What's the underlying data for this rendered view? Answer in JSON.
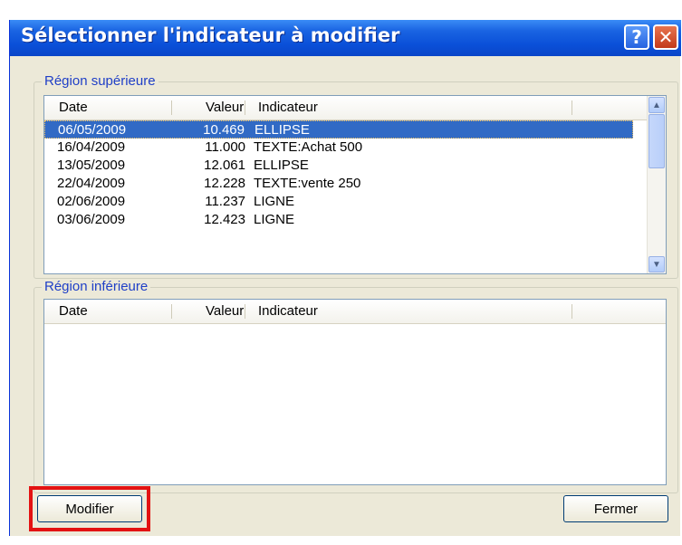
{
  "window": {
    "title": "Sélectionner l'indicateur à modifier",
    "help_label": "?",
    "close_label": "✕"
  },
  "upper_group": {
    "label": "Région supérieure",
    "columns": [
      "Date",
      "Valeur",
      "Indicateur"
    ],
    "rows": [
      {
        "date": "06/05/2009",
        "value": "10.469",
        "indicator": "ELLIPSE",
        "selected": true
      },
      {
        "date": "16/04/2009",
        "value": "11.000",
        "indicator": "TEXTE:Achat 500",
        "selected": false
      },
      {
        "date": "13/05/2009",
        "value": "12.061",
        "indicator": "ELLIPSE",
        "selected": false
      },
      {
        "date": "22/04/2009",
        "value": "12.228",
        "indicator": "TEXTE:vente 250",
        "selected": false
      },
      {
        "date": "02/06/2009",
        "value": "11.237",
        "indicator": "LIGNE",
        "selected": false
      },
      {
        "date": "03/06/2009",
        "value": "12.423",
        "indicator": "LIGNE",
        "selected": false
      }
    ],
    "scroll_up_icon": "chevron-up-icon",
    "scroll_down_icon": "chevron-down-icon"
  },
  "lower_group": {
    "label": "Région inférieure",
    "columns": [
      "Date",
      "Valeur",
      "Indicateur"
    ],
    "rows": []
  },
  "buttons": {
    "modify": "Modifier",
    "close": "Fermer"
  },
  "colors": {
    "title_bar": "#0a4fd8",
    "selection": "#316ac5",
    "highlight": "#e31212",
    "dialog_bg": "#ECE9D8"
  }
}
